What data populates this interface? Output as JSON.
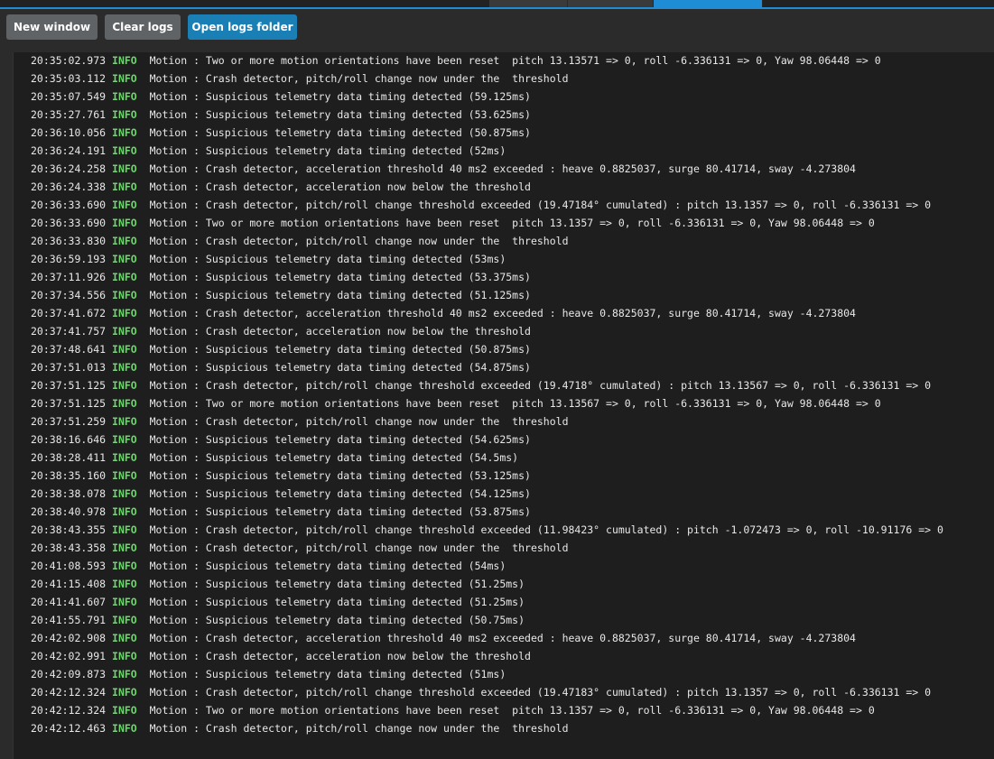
{
  "tabs": [
    {
      "label": ""
    },
    {
      "label": ""
    },
    {
      "label": ""
    }
  ],
  "toolbar": {
    "new_window": "New window",
    "clear_logs": "Clear logs",
    "open_logs_folder": "Open logs folder"
  },
  "colors": {
    "accent": "#1f8dd6",
    "primary_button": "#1a7fb5",
    "secondary_button": "#5f6366",
    "info_level": "#6dd66d",
    "log_background": "#1e1e1e"
  },
  "logs": [
    {
      "time": "20:35:02.973",
      "level": "INFO",
      "source": "Motion",
      "message": "Two or more motion orientations have been reset  pitch 13.13571 => 0, roll -6.336131 => 0, Yaw 98.06448 => 0"
    },
    {
      "time": "20:35:03.112",
      "level": "INFO",
      "source": "Motion",
      "message": "Crash detector, pitch/roll change now under the  threshold"
    },
    {
      "time": "20:35:07.549",
      "level": "INFO",
      "source": "Motion",
      "message": "Suspicious telemetry data timing detected (59.125ms)"
    },
    {
      "time": "20:35:27.761",
      "level": "INFO",
      "source": "Motion",
      "message": "Suspicious telemetry data timing detected (53.625ms)"
    },
    {
      "time": "20:36:10.056",
      "level": "INFO",
      "source": "Motion",
      "message": "Suspicious telemetry data timing detected (50.875ms)"
    },
    {
      "time": "20:36:24.191",
      "level": "INFO",
      "source": "Motion",
      "message": "Suspicious telemetry data timing detected (52ms)"
    },
    {
      "time": "20:36:24.258",
      "level": "INFO",
      "source": "Motion",
      "message": "Crash detector, acceleration threshold 40 ms2 exceeded : heave 0.8825037, surge 80.41714, sway -4.273804"
    },
    {
      "time": "20:36:24.338",
      "level": "INFO",
      "source": "Motion",
      "message": "Crash detector, acceleration now below the threshold"
    },
    {
      "time": "20:36:33.690",
      "level": "INFO",
      "source": "Motion",
      "message": "Crash detector, pitch/roll change threshold exceeded (19.47184° cumulated) : pitch 13.1357 => 0, roll -6.336131 => 0"
    },
    {
      "time": "20:36:33.690",
      "level": "INFO",
      "source": "Motion",
      "message": "Two or more motion orientations have been reset  pitch 13.1357 => 0, roll -6.336131 => 0, Yaw 98.06448 => 0"
    },
    {
      "time": "20:36:33.830",
      "level": "INFO",
      "source": "Motion",
      "message": "Crash detector, pitch/roll change now under the  threshold"
    },
    {
      "time": "20:36:59.193",
      "level": "INFO",
      "source": "Motion",
      "message": "Suspicious telemetry data timing detected (53ms)"
    },
    {
      "time": "20:37:11.926",
      "level": "INFO",
      "source": "Motion",
      "message": "Suspicious telemetry data timing detected (53.375ms)"
    },
    {
      "time": "20:37:34.556",
      "level": "INFO",
      "source": "Motion",
      "message": "Suspicious telemetry data timing detected (51.125ms)"
    },
    {
      "time": "20:37:41.672",
      "level": "INFO",
      "source": "Motion",
      "message": "Crash detector, acceleration threshold 40 ms2 exceeded : heave 0.8825037, surge 80.41714, sway -4.273804"
    },
    {
      "time": "20:37:41.757",
      "level": "INFO",
      "source": "Motion",
      "message": "Crash detector, acceleration now below the threshold"
    },
    {
      "time": "20:37:48.641",
      "level": "INFO",
      "source": "Motion",
      "message": "Suspicious telemetry data timing detected (50.875ms)"
    },
    {
      "time": "20:37:51.013",
      "level": "INFO",
      "source": "Motion",
      "message": "Suspicious telemetry data timing detected (54.875ms)"
    },
    {
      "time": "20:37:51.125",
      "level": "INFO",
      "source": "Motion",
      "message": "Crash detector, pitch/roll change threshold exceeded (19.4718° cumulated) : pitch 13.13567 => 0, roll -6.336131 => 0"
    },
    {
      "time": "20:37:51.125",
      "level": "INFO",
      "source": "Motion",
      "message": "Two or more motion orientations have been reset  pitch 13.13567 => 0, roll -6.336131 => 0, Yaw 98.06448 => 0"
    },
    {
      "time": "20:37:51.259",
      "level": "INFO",
      "source": "Motion",
      "message": "Crash detector, pitch/roll change now under the  threshold"
    },
    {
      "time": "20:38:16.646",
      "level": "INFO",
      "source": "Motion",
      "message": "Suspicious telemetry data timing detected (54.625ms)"
    },
    {
      "time": "20:38:28.411",
      "level": "INFO",
      "source": "Motion",
      "message": "Suspicious telemetry data timing detected (54.5ms)"
    },
    {
      "time": "20:38:35.160",
      "level": "INFO",
      "source": "Motion",
      "message": "Suspicious telemetry data timing detected (53.125ms)"
    },
    {
      "time": "20:38:38.078",
      "level": "INFO",
      "source": "Motion",
      "message": "Suspicious telemetry data timing detected (54.125ms)"
    },
    {
      "time": "20:38:40.978",
      "level": "INFO",
      "source": "Motion",
      "message": "Suspicious telemetry data timing detected (53.875ms)"
    },
    {
      "time": "20:38:43.355",
      "level": "INFO",
      "source": "Motion",
      "message": "Crash detector, pitch/roll change threshold exceeded (11.98423° cumulated) : pitch -1.072473 => 0, roll -10.91176 => 0"
    },
    {
      "time": "20:38:43.358",
      "level": "INFO",
      "source": "Motion",
      "message": "Crash detector, pitch/roll change now under the  threshold"
    },
    {
      "time": "20:41:08.593",
      "level": "INFO",
      "source": "Motion",
      "message": "Suspicious telemetry data timing detected (54ms)"
    },
    {
      "time": "20:41:15.408",
      "level": "INFO",
      "source": "Motion",
      "message": "Suspicious telemetry data timing detected (51.25ms)"
    },
    {
      "time": "20:41:41.607",
      "level": "INFO",
      "source": "Motion",
      "message": "Suspicious telemetry data timing detected (51.25ms)"
    },
    {
      "time": "20:41:55.791",
      "level": "INFO",
      "source": "Motion",
      "message": "Suspicious telemetry data timing detected (50.75ms)"
    },
    {
      "time": "20:42:02.908",
      "level": "INFO",
      "source": "Motion",
      "message": "Crash detector, acceleration threshold 40 ms2 exceeded : heave 0.8825037, surge 80.41714, sway -4.273804"
    },
    {
      "time": "20:42:02.991",
      "level": "INFO",
      "source": "Motion",
      "message": "Crash detector, acceleration now below the threshold"
    },
    {
      "time": "20:42:09.873",
      "level": "INFO",
      "source": "Motion",
      "message": "Suspicious telemetry data timing detected (51ms)"
    },
    {
      "time": "20:42:12.324",
      "level": "INFO",
      "source": "Motion",
      "message": "Crash detector, pitch/roll change threshold exceeded (19.47183° cumulated) : pitch 13.1357 => 0, roll -6.336131 => 0"
    },
    {
      "time": "20:42:12.324",
      "level": "INFO",
      "source": "Motion",
      "message": "Two or more motion orientations have been reset  pitch 13.1357 => 0, roll -6.336131 => 0, Yaw 98.06448 => 0"
    },
    {
      "time": "20:42:12.463",
      "level": "INFO",
      "source": "Motion",
      "message": "Crash detector, pitch/roll change now under the  threshold"
    }
  ]
}
